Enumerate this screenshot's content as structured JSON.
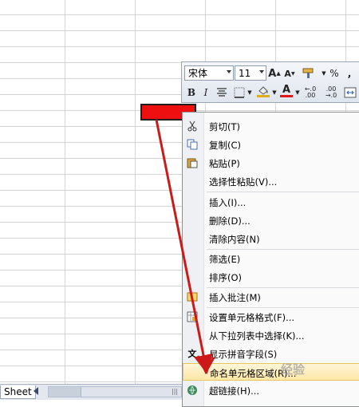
{
  "toolbar": {
    "font_name": "宋体",
    "font_size": "11",
    "bold": "B",
    "italic": "I",
    "percent": "%",
    "comma": ","
  },
  "context_menu": {
    "items": [
      {
        "label": "剪切(T)",
        "icon": "scissors-icon"
      },
      {
        "label": "复制(C)",
        "icon": "copy-icon"
      },
      {
        "label": "粘贴(P)",
        "icon": "paste-icon"
      },
      {
        "label": "选择性粘贴(V)...",
        "icon": ""
      },
      {
        "label": "插入(I)...",
        "icon": ""
      },
      {
        "label": "删除(D)...",
        "icon": ""
      },
      {
        "label": "清除内容(N)",
        "icon": ""
      },
      {
        "label": "筛选(E)",
        "icon": ""
      },
      {
        "label": "排序(O)",
        "icon": ""
      },
      {
        "label": "插入批注(M)",
        "icon": "comment-icon"
      },
      {
        "label": "设置单元格格式(F)...",
        "icon": "format-cells-icon"
      },
      {
        "label": "从下拉列表中选择(K)...",
        "icon": ""
      },
      {
        "label": "显示拼音字段(S)",
        "icon": "phonetic-icon"
      },
      {
        "label": "命名单元格区域(R)...",
        "icon": ""
      },
      {
        "label": "超链接(H)...",
        "icon": "hyperlink-icon"
      }
    ],
    "highlighted_index": 13
  },
  "sheet_tab": {
    "label": "Sheet"
  },
  "watermark": {
    "text": "经验"
  },
  "colors": {
    "selected_cell_fill": "#ee1010",
    "annotation_arrow": "#cc1a1a",
    "menu_highlight": "#fde7a8"
  }
}
